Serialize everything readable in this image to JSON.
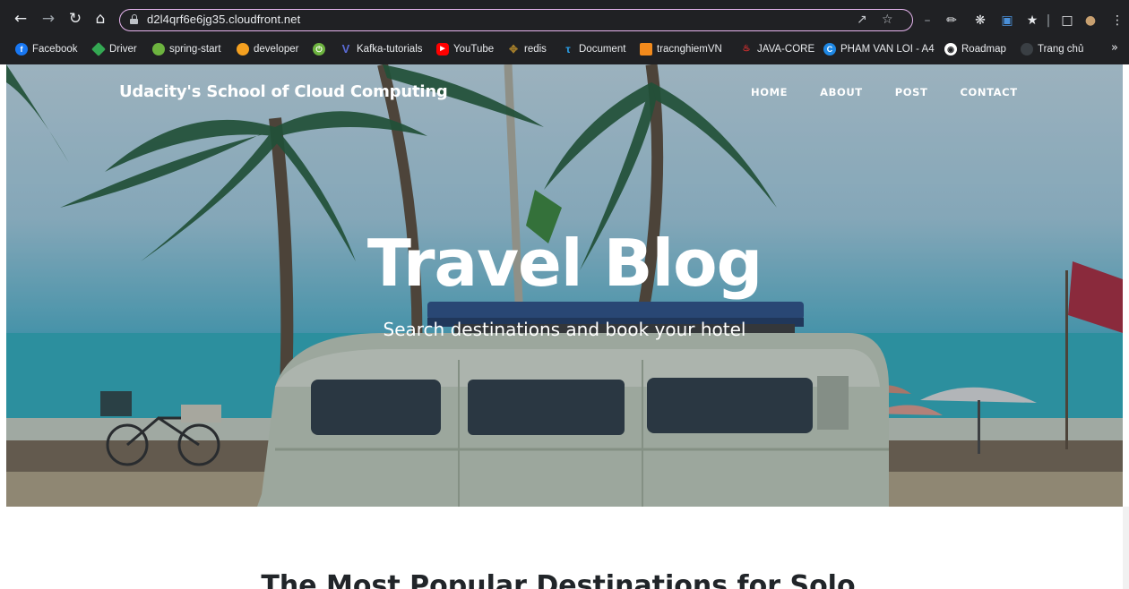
{
  "browser": {
    "url": "d2l4qrf6e6jg35.cloudfront.net",
    "nav_icons": [
      "back-arrow-icon",
      "forward-arrow-icon",
      "reload-icon",
      "home-icon"
    ],
    "bookmarks": [
      {
        "label": "Facebook",
        "color": "#1877f2"
      },
      {
        "label": "Driver",
        "color": "#34a853"
      },
      {
        "label": "spring-start",
        "color": "#6db33f"
      },
      {
        "label": "developer",
        "color": "#f4a020"
      },
      {
        "label": "",
        "color": "#6db33f"
      },
      {
        "label": "Kafka-tutorials",
        "color": "#5b6bd6"
      },
      {
        "label": "YouTube",
        "color": "#ff0000"
      },
      {
        "label": "redis",
        "color": "#a07b2a"
      },
      {
        "label": "Document",
        "color": "#2aa0e8"
      },
      {
        "label": "tracnghiemVN",
        "color": "#f28a1c"
      },
      {
        "label": "JAVA-CORE",
        "color": "#d32f2f"
      },
      {
        "label": "PHAM VAN LOI - A4",
        "color": "#1e88e5"
      },
      {
        "label": "Roadmap",
        "color": "#ffffff"
      },
      {
        "label": "Trang chủ",
        "color": "#3a3f44"
      }
    ],
    "more_bookmarks": "»"
  },
  "site": {
    "brand": "Udacity's School of Cloud Computing",
    "nav": [
      "HOME",
      "ABOUT",
      "POST",
      "CONTACT"
    ]
  },
  "hero": {
    "title": "Travel Blog",
    "subtitle": "Search destinations and book your hotel"
  },
  "main": {
    "section_title": "The Most Popular Destinations for Solo"
  }
}
